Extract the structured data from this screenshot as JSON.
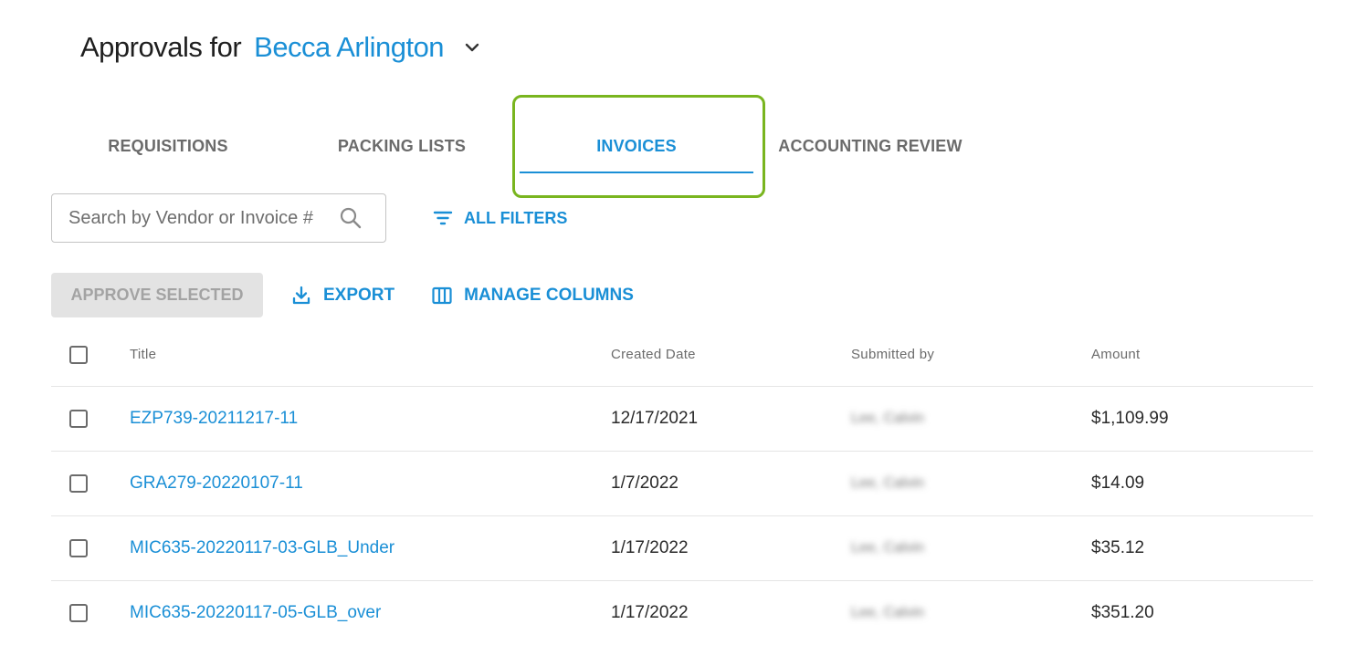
{
  "header": {
    "prefix": "Approvals for",
    "user_name": "Becca Arlington",
    "dropdown_icon": "chevron-down-icon"
  },
  "tabs": [
    {
      "label": "REQUISITIONS",
      "active": false
    },
    {
      "label": "PACKING LISTS",
      "active": false
    },
    {
      "label": "INVOICES",
      "active": true
    },
    {
      "label": "ACCOUNTING REVIEW",
      "active": false
    }
  ],
  "search": {
    "placeholder": "Search by Vendor or Invoice #",
    "value": "",
    "icon": "search-icon"
  },
  "filters": {
    "label": "ALL FILTERS",
    "icon": "filter-icon"
  },
  "toolbar": {
    "approve_label": "APPROVE SELECTED",
    "approve_disabled": true,
    "export_label": "EXPORT",
    "export_icon": "download-icon",
    "manage_label": "MANAGE COLUMNS",
    "manage_icon": "columns-icon"
  },
  "table": {
    "columns": [
      "Title",
      "Created Date",
      "Submitted by",
      "Amount"
    ],
    "rows": [
      {
        "title": "EZP739-20211217-11",
        "created": "12/17/2021",
        "submitted_by": "Lee, Calvin",
        "amount": "$1,109.99"
      },
      {
        "title": "GRA279-20220107-11",
        "created": "1/7/2022",
        "submitted_by": "Lee, Calvin",
        "amount": "$14.09"
      },
      {
        "title": "MIC635-20220117-03-GLB_Under",
        "created": "1/17/2022",
        "submitted_by": "Lee, Calvin",
        "amount": "$35.12"
      },
      {
        "title": "MIC635-20220117-05-GLB_over",
        "created": "1/17/2022",
        "submitted_by": "Lee, Calvin",
        "amount": "$351.20"
      }
    ]
  },
  "colors": {
    "accent": "#1a8fd6",
    "highlight": "#79b51f",
    "disabled_bg": "#e3e3e3",
    "disabled_text": "#a3a3a3"
  }
}
